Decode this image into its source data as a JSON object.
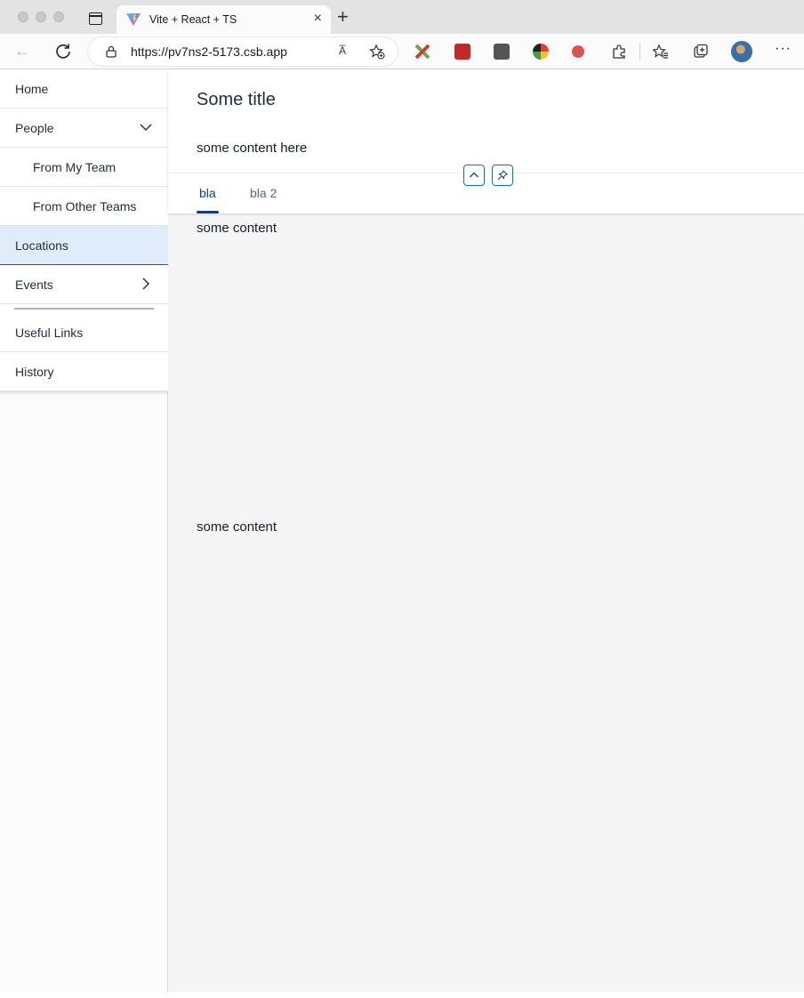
{
  "browser": {
    "tab_title": "Vite + React + TS",
    "url": "https://pv7ns2-5173.csb.app",
    "read_aloud_label": "A̅",
    "more_label": "···"
  },
  "sidenav": {
    "items": [
      {
        "label": "Home"
      },
      {
        "label": "People"
      },
      {
        "label": "From My Team"
      },
      {
        "label": "From Other Teams"
      },
      {
        "label": "Locations"
      },
      {
        "label": "Events"
      },
      {
        "label": "Useful Links"
      },
      {
        "label": "History"
      }
    ]
  },
  "page": {
    "title": "Some title",
    "header_content": "some content here",
    "tabs": [
      {
        "label": "bla"
      },
      {
        "label": "bla 2"
      }
    ],
    "content_1": "some content",
    "content_2": "some content"
  },
  "colors": {
    "accent": "#0a3f8a",
    "selection_bg": "#e0ecfa",
    "button_border": "#0a6ed1"
  }
}
